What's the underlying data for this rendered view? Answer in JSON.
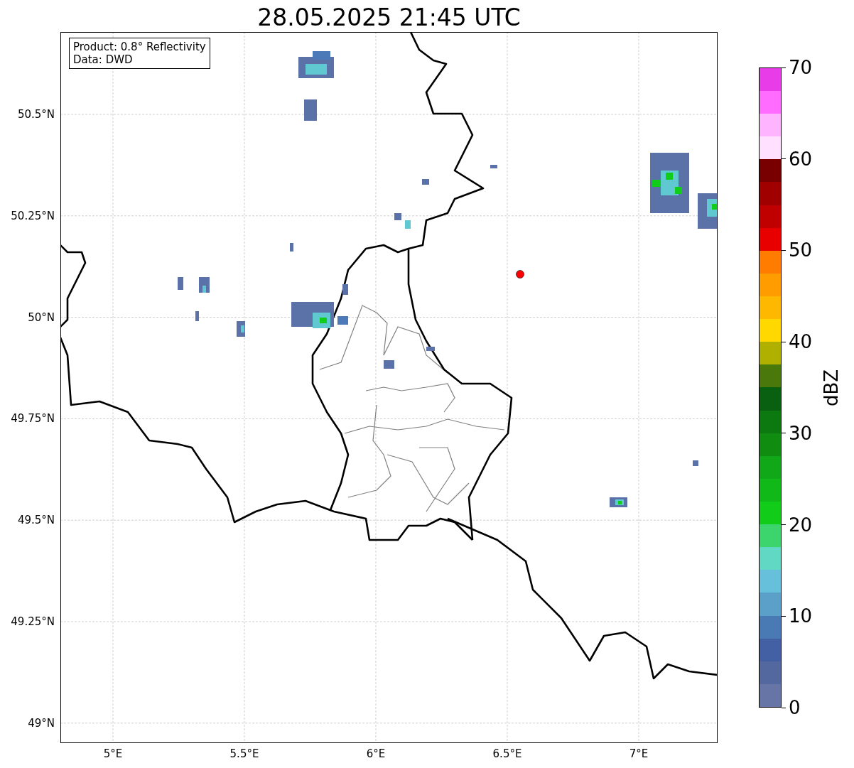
{
  "title": "28.05.2025 21:45 UTC",
  "info_box": [
    "Product: 0.8° Reflectivity",
    "Data: DWD"
  ],
  "map": {
    "y_tick_labels": [
      "50.5°N",
      "50.25°N",
      "50°N",
      "49.75°N",
      "49.5°N",
      "49.25°N",
      "49°N"
    ],
    "x_tick_labels": [
      "5°E",
      "5.5°E",
      "6°E",
      "6.5°E",
      "7°E"
    ]
  },
  "colorbar": {
    "label": "dBZ",
    "tick_labels": [
      "70",
      "60",
      "50",
      "40",
      "30",
      "20",
      "10",
      "0"
    ],
    "bins": [
      {
        "color": "#6674a6"
      },
      {
        "color": "#5468a0"
      },
      {
        "color": "#4460a4"
      },
      {
        "color": "#4a7ab4"
      },
      {
        "color": "#5aa0c8"
      },
      {
        "color": "#66c0dc"
      },
      {
        "color": "#60d8c4"
      },
      {
        "color": "#3cd46c"
      },
      {
        "color": "#12cc1a"
      },
      {
        "color": "#10b818"
      },
      {
        "color": "#10a818"
      },
      {
        "color": "#108c10"
      },
      {
        "color": "#0c7810"
      },
      {
        "color": "#086010"
      },
      {
        "color": "#4a780a"
      },
      {
        "color": "#b0b000"
      },
      {
        "color": "#ffd800"
      },
      {
        "color": "#ffb800"
      },
      {
        "color": "#ff9c00"
      },
      {
        "color": "#ff7c00"
      },
      {
        "color": "#e80000"
      },
      {
        "color": "#c00000"
      },
      {
        "color": "#a00000"
      },
      {
        "color": "#780000"
      },
      {
        "color": "#ffe0ff"
      },
      {
        "color": "#ffb4ff"
      },
      {
        "color": "#ff6cff"
      },
      {
        "color": "#e83ce8"
      }
    ]
  }
}
